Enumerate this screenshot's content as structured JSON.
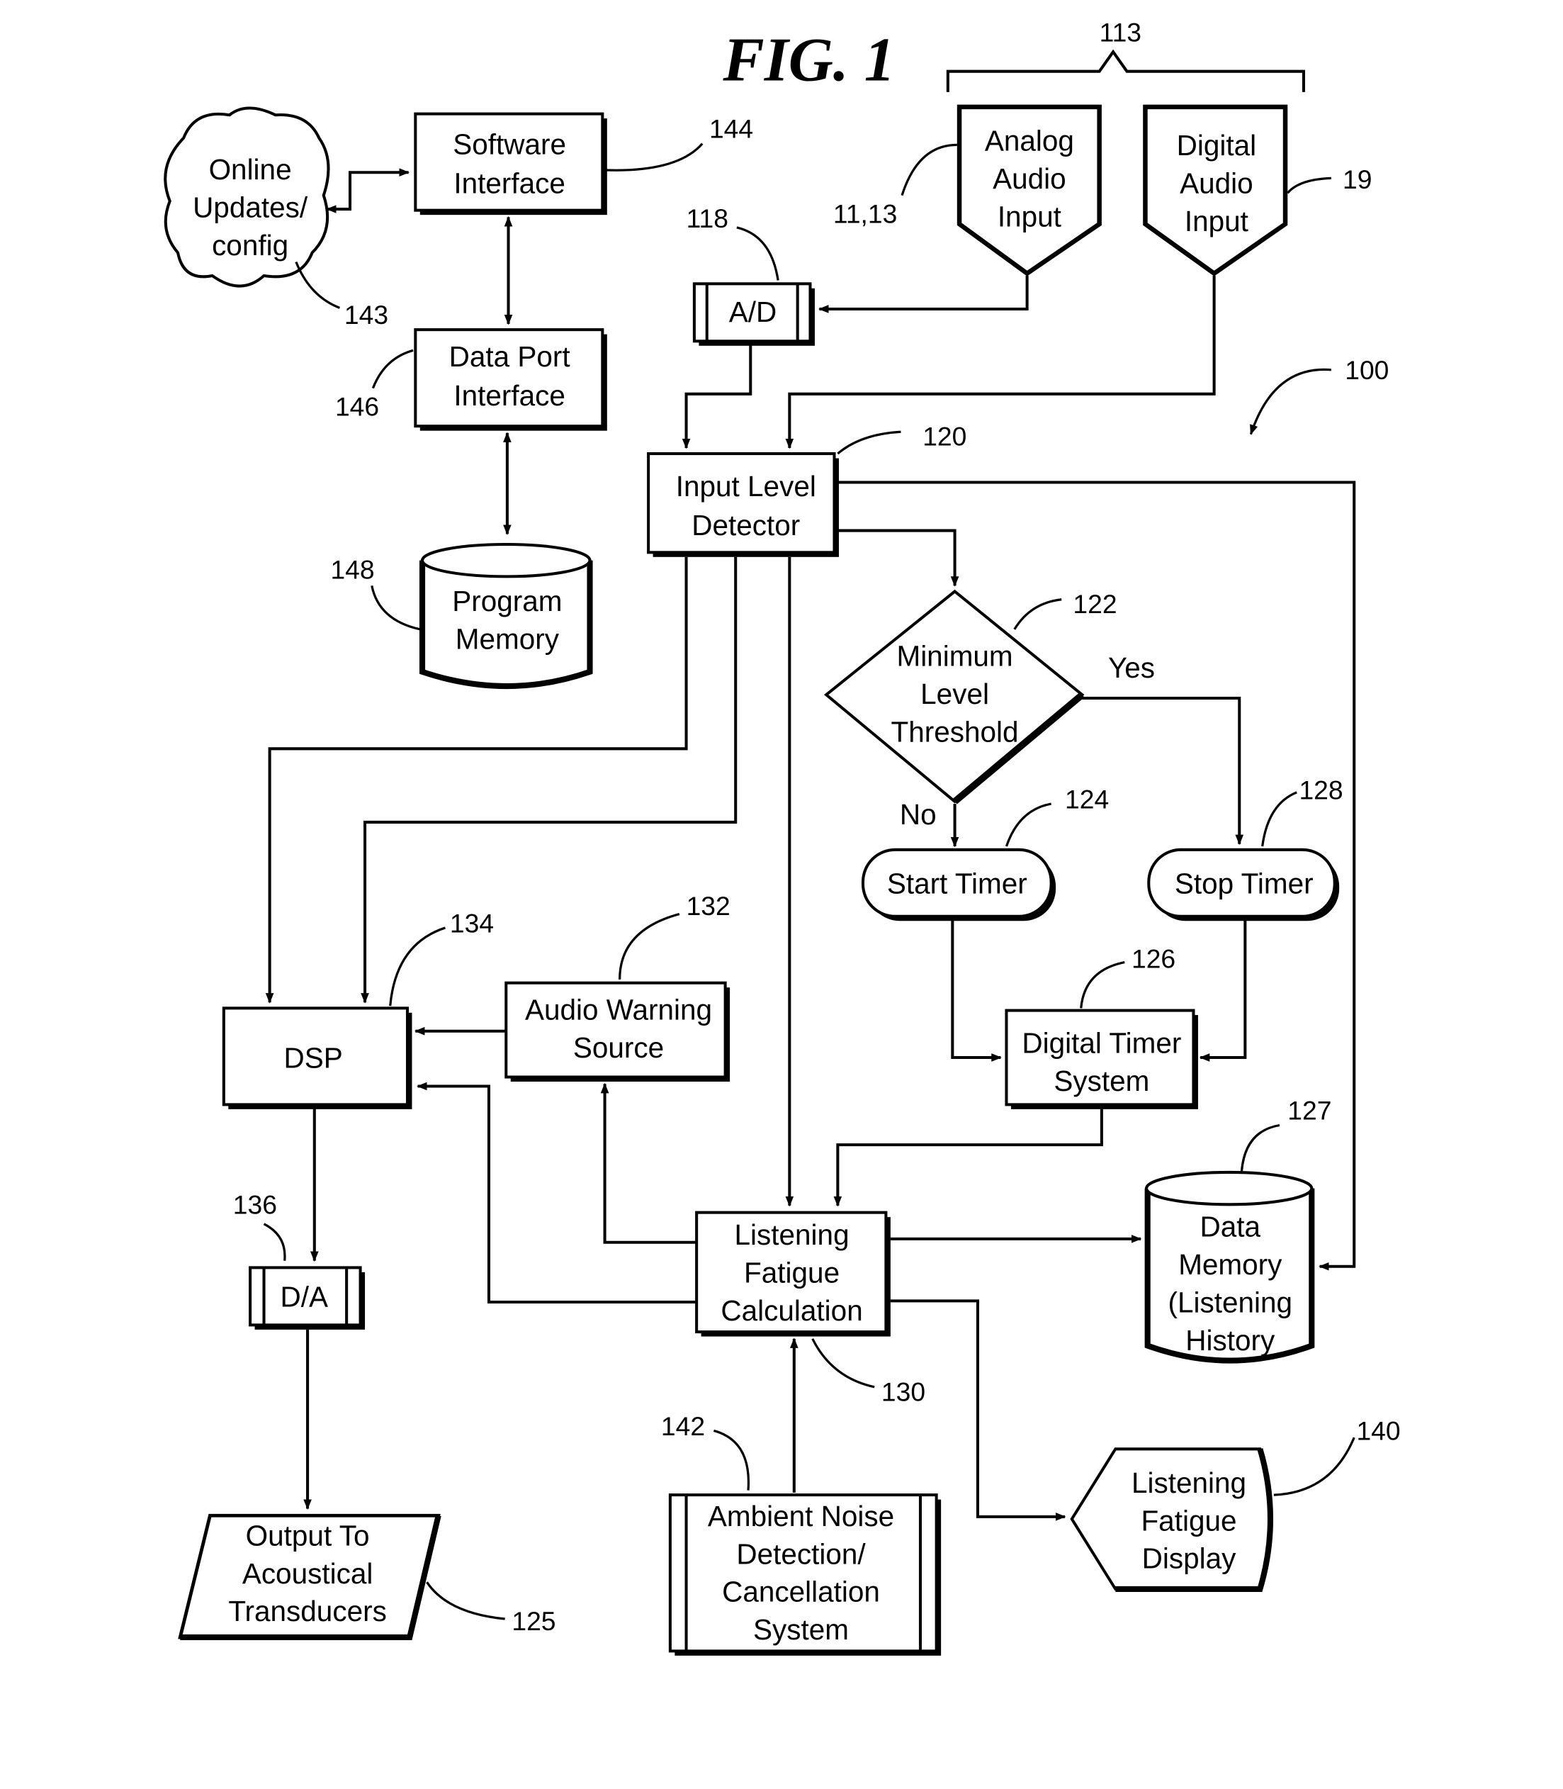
{
  "figure": {
    "title": "FIG. 1",
    "system_ref": "100",
    "group_ref": "113"
  },
  "nodes": {
    "online_updates": {
      "lines": [
        "Online",
        "Updates/",
        "config"
      ],
      "ref": "143"
    },
    "software_interface": {
      "lines": [
        "Software",
        "Interface"
      ],
      "ref": "144"
    },
    "data_port_interface": {
      "lines": [
        "Data Port",
        "Interface"
      ],
      "ref": "146"
    },
    "program_memory": {
      "lines": [
        "Program",
        "Memory"
      ],
      "ref": "148"
    },
    "analog_audio_input": {
      "lines": [
        "Analog",
        "Audio",
        "Input"
      ],
      "ref": "11,13"
    },
    "digital_audio_input": {
      "lines": [
        "Digital",
        "Audio",
        "Input"
      ],
      "ref": "19"
    },
    "ad_converter": {
      "lines": [
        "A/D"
      ],
      "ref": "118"
    },
    "input_level_detector": {
      "lines": [
        "Input Level",
        "Detector"
      ],
      "ref": "120"
    },
    "min_level_threshold": {
      "lines": [
        "Minimum",
        "Level",
        "Threshold"
      ],
      "ref": "122",
      "yes_label": "Yes",
      "no_label": "No"
    },
    "start_timer": {
      "lines": [
        "Start Timer"
      ],
      "ref": "124"
    },
    "stop_timer": {
      "lines": [
        "Stop Timer"
      ],
      "ref": "128"
    },
    "digital_timer_system": {
      "lines": [
        "Digital Timer",
        "System"
      ],
      "ref": "126"
    },
    "data_memory": {
      "lines": [
        "Data",
        "Memory",
        "(Listening",
        "History"
      ],
      "ref": "127"
    },
    "dsp": {
      "lines": [
        "DSP"
      ],
      "ref": "134"
    },
    "audio_warning_source": {
      "lines": [
        "Audio Warning",
        "Source"
      ],
      "ref": "132"
    },
    "da_converter": {
      "lines": [
        "D/A"
      ],
      "ref": "136"
    },
    "listening_fatigue_calculation": {
      "lines": [
        "Listening",
        "Fatigue",
        "Calculation"
      ],
      "ref": "130"
    },
    "output_transducers": {
      "lines": [
        "Output To",
        "Acoustical",
        "Transducers"
      ],
      "ref": "125"
    },
    "ambient_noise_system": {
      "lines": [
        "Ambient Noise",
        "Detection/",
        "Cancellation",
        "System"
      ],
      "ref": "142"
    },
    "listening_fatigue_display": {
      "lines": [
        "Listening",
        "Fatigue",
        "Display"
      ],
      "ref": "140"
    }
  }
}
